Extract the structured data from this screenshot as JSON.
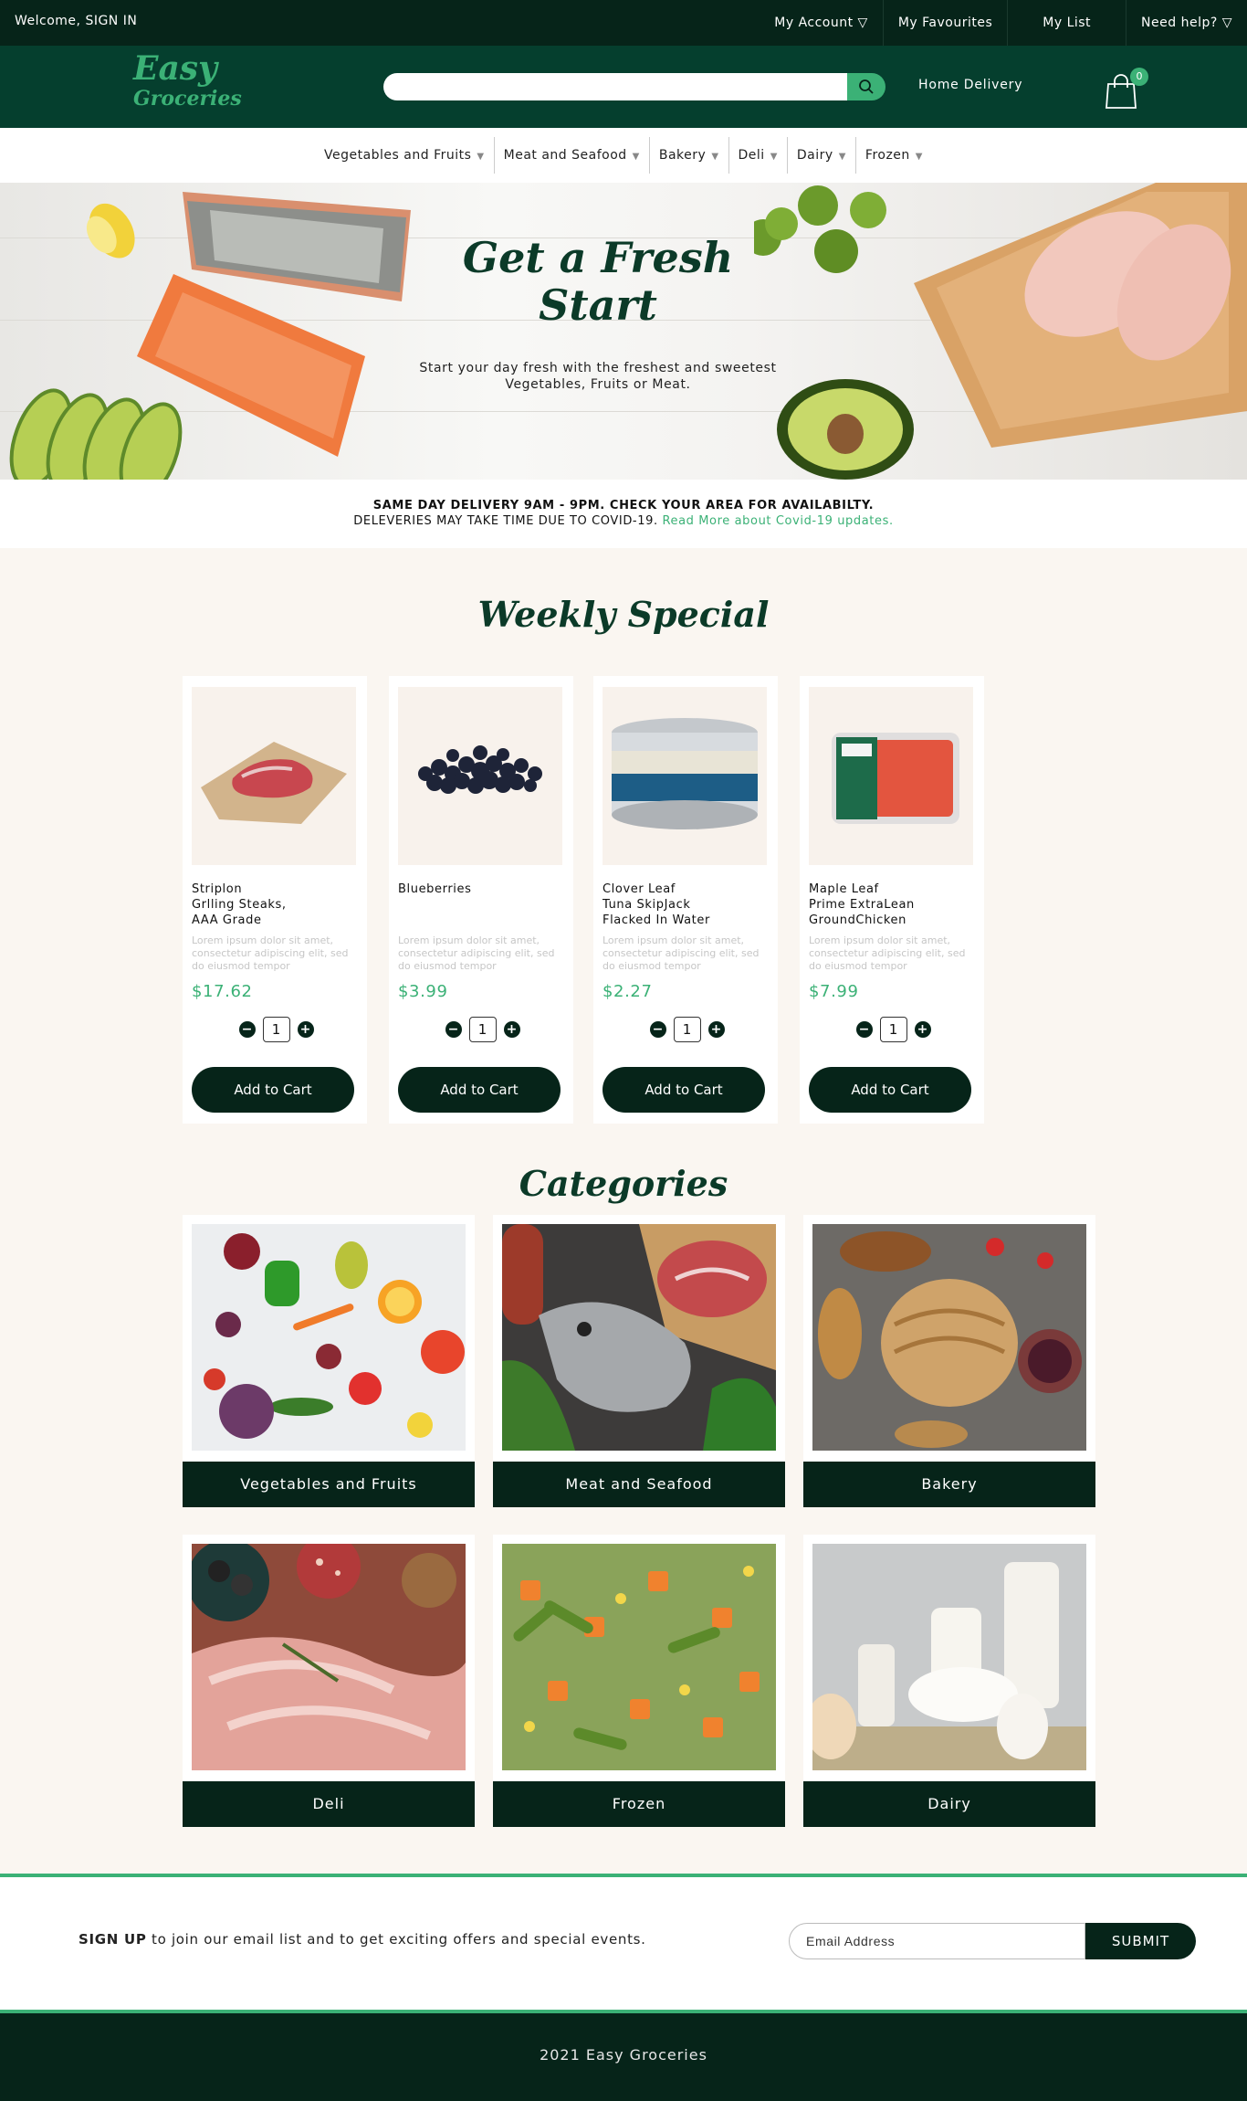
{
  "topbar": {
    "welcome": "Welcome, SIGN IN",
    "links": [
      "My Account ▽",
      "My Favourites",
      "My List",
      "Need help? ▽"
    ]
  },
  "header": {
    "logo_line1": "Easy",
    "logo_line2": "Groceries",
    "search_placeholder": "",
    "home_delivery": "Home Delivery",
    "cart_count": "0"
  },
  "nav": {
    "items": [
      "Vegetables and Fruits",
      "Meat and Seafood",
      "Bakery",
      "Deli",
      "Dairy",
      "Frozen"
    ]
  },
  "hero": {
    "title_line1": "Get a Fresh",
    "title_line2": "Start",
    "subtitle_line1": "Start your day fresh with the freshest and sweetest",
    "subtitle_line2": "Vegetables, Fruits or Meat."
  },
  "notice": {
    "line1": "SAME DAY DELIVERY 9AM - 9PM. CHECK YOUR AREA FOR AVAILABILTY.",
    "line2": "DELEVERIES MAY TAKE TIME DUE TO COVID-19.",
    "link": "Read More about Covid-19 updates."
  },
  "weekly": {
    "title": "Weekly Special",
    "products": [
      {
        "name": "Striplon\nGrlling Steaks,\nAAA Grade",
        "desc": "Lorem ipsum dolor sit amet, consectetur adipiscing elit, sed do eiusmod tempor",
        "price": "$17.62",
        "qty": "1",
        "button": "Add to Cart"
      },
      {
        "name": "Blueberries",
        "desc": "Lorem ipsum dolor sit amet, consectetur adipiscing elit, sed do eiusmod tempor",
        "price": "$3.99",
        "qty": "1",
        "button": "Add to Cart"
      },
      {
        "name": "Clover Leaf\nTuna SkipJack\nFlacked In Water",
        "desc": "Lorem ipsum dolor sit amet, consectetur adipiscing elit, sed do eiusmod tempor",
        "price": "$2.27",
        "qty": "1",
        "button": "Add to Cart"
      },
      {
        "name": "Maple Leaf\nPrime ExtraLean\nGroundChicken",
        "desc": "Lorem ipsum dolor sit amet, consectetur adipiscing elit, sed do eiusmod tempor",
        "price": "$7.99",
        "qty": "1",
        "button": "Add to Cart"
      }
    ]
  },
  "categories": {
    "title": "Categories",
    "items": [
      "Vegetables and Fruits",
      "Meat and Seafood",
      "Bakery",
      "Deli",
      "Frozen",
      "Dairy"
    ]
  },
  "signup": {
    "bold": "SIGN UP",
    "text": " to join our email list and to get exciting offers and special events.",
    "email_placeholder": "Email Address",
    "submit": "SUBMIT"
  },
  "footer": {
    "text": "2021 Easy Groceries"
  },
  "colors": {
    "dark": "#062419",
    "header": "#053f2e",
    "accent": "#3bb176",
    "page_bg": "#faf6f1"
  }
}
